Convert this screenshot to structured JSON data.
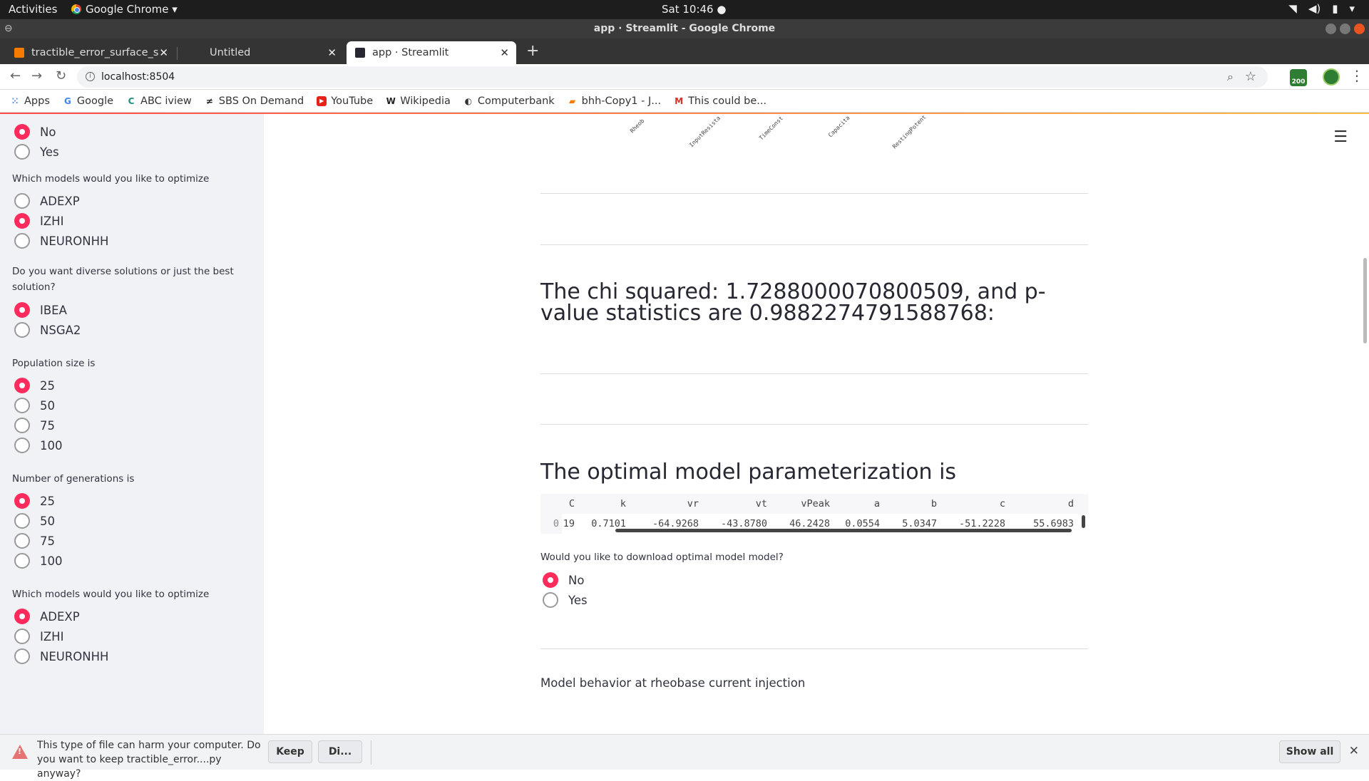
{
  "os_bar": {
    "activities": "Activities",
    "app_menu": "Google Chrome ▾",
    "clock": "Sat 10:46 ●"
  },
  "window": {
    "title": "app · Streamlit - Google Chrome"
  },
  "tabs": [
    {
      "label": "tractible_error_surface_s"
    },
    {
      "label": "Untitled"
    },
    {
      "label": "app · Streamlit"
    }
  ],
  "omnibox": {
    "url": "localhost:8504"
  },
  "extension_badge": "200",
  "bookmarks": [
    {
      "label": "Apps",
      "icon": "apps-grid-icon"
    },
    {
      "label": "Google",
      "icon": "google-icon"
    },
    {
      "label": "ABC iview",
      "icon": "abc-iview-icon"
    },
    {
      "label": "SBS On Demand",
      "icon": "sbs-icon"
    },
    {
      "label": "YouTube",
      "icon": "youtube-icon"
    },
    {
      "label": "Wikipedia",
      "icon": "wikipedia-icon"
    },
    {
      "label": "Computerbank",
      "icon": "computerbank-icon"
    },
    {
      "label": "bhh-Copy1 - J...",
      "icon": "jupyter-icon"
    },
    {
      "label": "This could be...",
      "icon": "gmail-icon"
    }
  ],
  "sidebar": {
    "top_radio": {
      "options": [
        "No",
        "Yes"
      ],
      "selected": "No"
    },
    "models1": {
      "label": "Which models would you like to optimize",
      "options": [
        "ADEXP",
        "IZHI",
        "NEURONHH"
      ],
      "selected": "IZHI"
    },
    "diversity": {
      "label": "Do you want diverse solutions or just the best solution?",
      "options": [
        "IBEA",
        "NSGA2"
      ],
      "selected": "IBEA"
    },
    "population": {
      "label": "Population size is",
      "options": [
        "25",
        "50",
        "75",
        "100"
      ],
      "selected": "25"
    },
    "generations": {
      "label": "Number of generations is",
      "options": [
        "25",
        "50",
        "75",
        "100"
      ],
      "selected": "25"
    },
    "models2": {
      "label": "Which models would you like to optimize",
      "options": [
        "ADEXP",
        "IZHI",
        "NEURONHH"
      ],
      "selected": "ADEXP"
    }
  },
  "main": {
    "plot_axis_labels": [
      "Rheob",
      "InputResista",
      "TimeConst",
      "Capacita",
      "RestingPotent"
    ],
    "chi_heading": "The chi squared: 1.7288000070800509, and p-value statistics are 0.9882274791588768:",
    "optimal_heading": "The optimal model parameterization is",
    "table": {
      "columns": [
        "C",
        "k",
        "vr",
        "vt",
        "vPeak",
        "a",
        "b",
        "c",
        "d"
      ],
      "rows": [
        {
          "index": "0",
          "values": [
            "19",
            "0.7101",
            "-64.9268",
            "-43.8780",
            "46.2428",
            "0.0554",
            "5.0347",
            "-51.2228",
            "55.6983"
          ]
        }
      ]
    },
    "download_question": {
      "label": "Would you like to download optimal model model?",
      "options": [
        "No",
        "Yes"
      ],
      "selected": "No"
    },
    "rheobase_text": "Model behavior at rheobase current injection"
  },
  "download_bar": {
    "message": "This type of file can harm your computer. Do you want to keep tractible_error....py anyway?",
    "keep": "Keep",
    "discard": "Di...",
    "show_all": "Show all"
  },
  "colors": {
    "accent": "#ff2b5c",
    "sidebar_bg": "#f0f2f6"
  }
}
